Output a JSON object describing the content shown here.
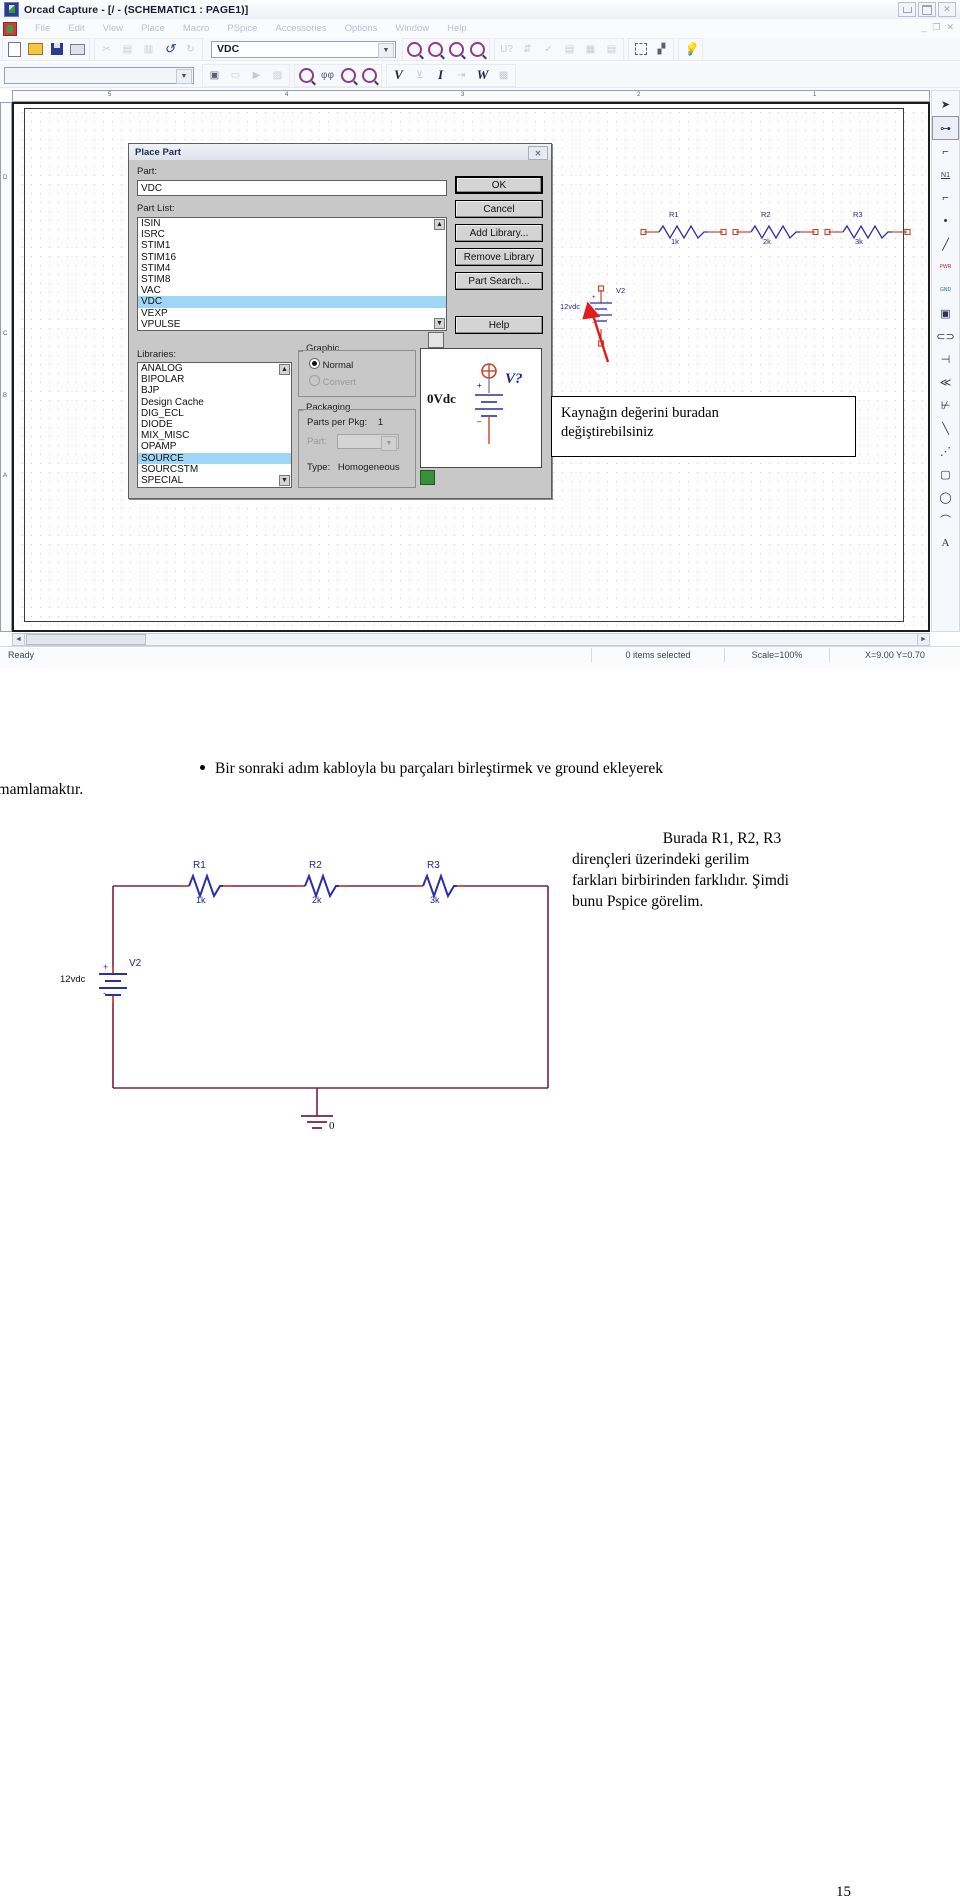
{
  "window": {
    "title": "Orcad Capture - [/ - (SCHEMATIC1 : PAGE1)]",
    "app_icon": "orcad-capture-icon",
    "controls": {
      "minimize": "–",
      "maximize": "□",
      "close": "✕"
    },
    "mdi_controls": {
      "minimize": "_",
      "restore": "❐",
      "close": "✕"
    }
  },
  "menubar": {
    "items": [
      "File",
      "Edit",
      "View",
      "Place",
      "Macro",
      "PSpice",
      "Accessories",
      "Options",
      "Window",
      "Help"
    ]
  },
  "toolbar_main": {
    "part_combo_value": "VDC",
    "part_combo_arrow": "▼",
    "buttons": [
      "new-icon",
      "open-icon",
      "save-icon",
      "print-icon",
      "cut-icon",
      "copy-icon",
      "paste-icon",
      "undo-icon",
      "redo-icon",
      "zoom-in-icon",
      "zoom-out-icon",
      "zoom-area-icon",
      "zoom-fit-icon",
      "annotate-icon",
      "drc-icon",
      "netlist-icon",
      "bom-icon",
      "crossref-icon",
      "export-icon",
      "select-icon",
      "properties-icon",
      "help-icon"
    ]
  },
  "toolbar_pspice": {
    "profile_combo_value": "",
    "profile_combo_arrow": "▼",
    "buttons": [
      "new-simulation-icon",
      "edit-simulation-icon",
      "run-icon",
      "view-results-icon",
      "voltage-marker-icon",
      "differential-marker-icon",
      "current-marker-icon",
      "power-marker-icon",
      "enable-voltage-icon",
      "enable-bias-icon",
      "enable-current-icon",
      "enable-power-icon",
      "enable-dissipation-icon"
    ],
    "letter_buttons": [
      "V",
      "I",
      "W"
    ]
  },
  "editor": {
    "ruler_h_ticks": [
      "5",
      "4",
      "3",
      "2",
      "1"
    ],
    "ruler_v_ticks": [
      "D",
      "C",
      "B",
      "A"
    ],
    "scrollbars": {
      "up": "▲",
      "down": "▼",
      "left": "◄",
      "right": "►"
    }
  },
  "palette": {
    "tools": [
      "select-arrow-icon",
      "place-part-icon",
      "place-wire-icon",
      "place-net-alias-icon",
      "place-bus-icon",
      "place-junction-icon",
      "place-bus-entry-icon",
      "place-power-icon",
      "place-ground-icon",
      "place-hierarchical-block-icon",
      "place-port-icon",
      "place-pin-icon",
      "place-off-page-connector-icon",
      "place-no-connect-icon",
      "place-line-icon",
      "place-polyline-icon",
      "place-rectangle-icon",
      "place-ellipse-icon",
      "place-arc-icon",
      "place-text-icon"
    ],
    "labels": {
      "net_alias": "N1",
      "power": "PWR",
      "ground": "GND"
    }
  },
  "dialog": {
    "title": "Place Part",
    "close_label": "✕",
    "part_label": "Part:",
    "part_value": "VDC",
    "part_list_label": "Part List:",
    "part_list": [
      "ISIN",
      "ISRC",
      "STIM1",
      "STIM16",
      "STIM4",
      "STIM8",
      "VAC",
      "VDC",
      "VEXP",
      "VPULSE"
    ],
    "part_list_selected": "VDC",
    "libraries_label": "Libraries:",
    "libraries": [
      "ANALOG",
      "BIPOLAR",
      "BJP",
      "Design Cache",
      "DIG_ECL",
      "DIODE",
      "MIX_MISC",
      "OPAMP",
      "SOURCE",
      "SOURCSTM",
      "SPECIAL"
    ],
    "libraries_selected": "SOURCE",
    "buttons": [
      "OK",
      "Cancel",
      "Add Library...",
      "Remove Library",
      "Part Search...",
      "Help"
    ],
    "graphic": {
      "legend": "Graphic",
      "options": [
        "Normal",
        "Convert"
      ],
      "selected": "Normal",
      "disabled": [
        "Convert"
      ]
    },
    "packaging": {
      "legend": "Packaging",
      "parts_per_pkg_label": "Parts per Pkg:",
      "parts_per_pkg_value": "1",
      "part_label": "Part:",
      "part_value": "",
      "type_label": "Type:",
      "type_value": "Homogeneous"
    },
    "preview": {
      "value_label": "0Vdc",
      "ref_label": "V?",
      "plus": "+",
      "minus": "–"
    },
    "scroll_up": "▲",
    "scroll_down": "▼"
  },
  "schematic_top": {
    "resistors": [
      {
        "ref": "R1",
        "value": "1k"
      },
      {
        "ref": "R2",
        "value": "2k"
      },
      {
        "ref": "R3",
        "value": "3k"
      }
    ],
    "source": {
      "ref": "V2",
      "value": "12vdc",
      "plus": "+",
      "minus": "-"
    },
    "annotation_arrow": "red-arrow-icon"
  },
  "callout": {
    "line1": "Kaynağın değerini buradan",
    "line2": "değiştirebilsiniz"
  },
  "statusbar": {
    "ready": "Ready",
    "selection": "0 items selected",
    "scale": "Scale=100%",
    "coords": "X=9.00  Y=0.70"
  },
  "document": {
    "bullet_paragraph": "Bir sonraki adım kabloyla bu parçaları birleştirmek ve ground ekleyerek devreyi tamamlamaktır.",
    "bullet_line1": "Bir sonraki adım kabloyla bu parçaları birleştirmek ve ground ekleyerek",
    "bullet_line2": "devreyi tamamlamaktır.",
    "right_paragraph_line1": "Burada R1, R2, R3",
    "right_paragraph_line2": "dirençleri üzerindeki gerilim",
    "right_paragraph_line3": "farkları birbirinden farklıdır. Şimdi",
    "right_paragraph_line4": "bunu Pspice görelim.",
    "page_number": "15"
  },
  "circuit": {
    "resistors": [
      {
        "ref": "R1",
        "value": "1k"
      },
      {
        "ref": "R2",
        "value": "2k"
      },
      {
        "ref": "R3",
        "value": "3k"
      }
    ],
    "source": {
      "ref": "V2",
      "value": "12vdc",
      "plus": "+",
      "minus": "-"
    },
    "ground": {
      "label": "0"
    }
  },
  "colors": {
    "wire": "#7a2040",
    "symbol": "#2b2fa8",
    "pin": "#c4462a",
    "label": "#1b2a8c",
    "selection_blue": "#9fd6f5",
    "arrow_red": "#e21b1b",
    "dialog_face": "#c8c8c8"
  }
}
